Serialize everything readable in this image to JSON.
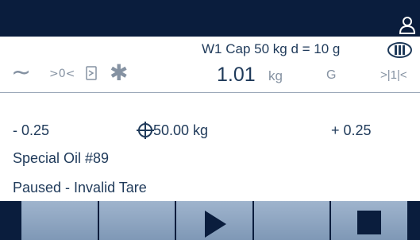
{
  "header": {
    "capacity": "W1 Cap 50 kg d = 10 g",
    "accuracy_class_icon": "accuracy-class-iii-icon",
    "user_icon": "user-icon"
  },
  "weight_display": {
    "value": "1.01",
    "unit": "kg",
    "mode": "G",
    "scale_number": ">|1|<",
    "zero_symbol": ">0<",
    "motion_symbol": "~",
    "asterisk_symbol": "✱"
  },
  "target": {
    "tolerance_minus": "- 0.25",
    "target_value": "50.00 kg",
    "tolerance_plus": "+ 0.25"
  },
  "material": "Special Oil #89",
  "status_message": "Paused - Invalid Tare",
  "softkeys": [
    {
      "icon": "",
      "label": ""
    },
    {
      "icon": "",
      "label": ""
    },
    {
      "icon": "play-icon",
      "label": ""
    },
    {
      "icon": "",
      "label": ""
    },
    {
      "icon": "stop-icon",
      "label": ""
    }
  ],
  "colors": {
    "topbar": "#0a1d3d",
    "text_primary": "#1f3a5a",
    "text_muted": "#8592a2",
    "softkey": "#8ea6c4"
  }
}
